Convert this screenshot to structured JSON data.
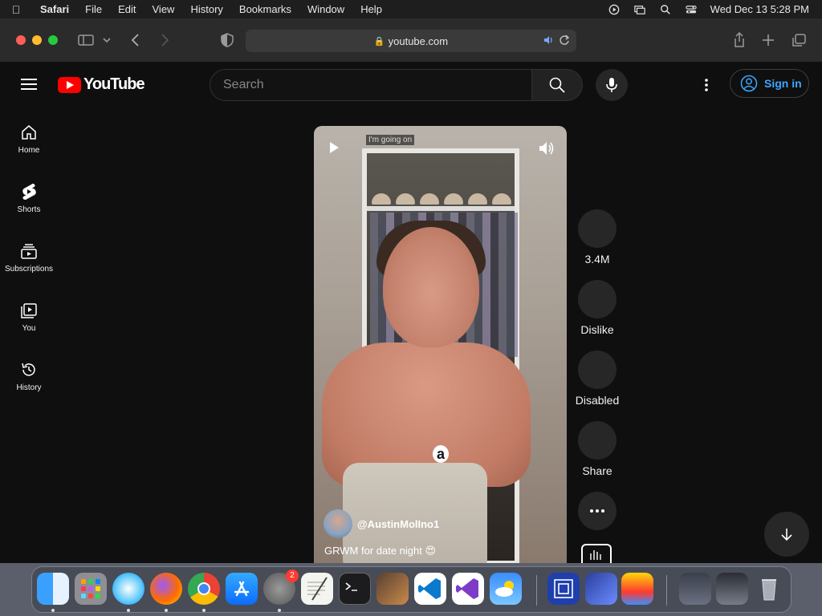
{
  "menubar": {
    "app": "Safari",
    "items": [
      "File",
      "Edit",
      "View",
      "History",
      "Bookmarks",
      "Window",
      "Help"
    ],
    "datetime": "Wed Dec 13  5:28 PM"
  },
  "safari": {
    "url": "youtube.com"
  },
  "youtube": {
    "logo_text": "YouTube",
    "search_placeholder": "Search",
    "signin_label": "Sign in",
    "nav": [
      {
        "label": "Home",
        "icon": "home-icon"
      },
      {
        "label": "Shorts",
        "icon": "shorts-icon"
      },
      {
        "label": "Subscriptions",
        "icon": "subscriptions-icon"
      },
      {
        "label": "You",
        "icon": "you-icon"
      },
      {
        "label": "History",
        "icon": "history-icon"
      }
    ],
    "short": {
      "caption_chip": "I'm going on",
      "channel_handle": "@AustinMolIno1",
      "title": "GRWM for date night 😍"
    },
    "actions": {
      "like": "3.4M",
      "dislike": "Dislike",
      "comments": "Disabled",
      "share": "Share"
    }
  },
  "dock": {
    "settings_badge": "2"
  },
  "colors": {
    "youtube_red": "#ff0000",
    "link_blue": "#3ea6ff",
    "background": "#0f0f0f"
  }
}
